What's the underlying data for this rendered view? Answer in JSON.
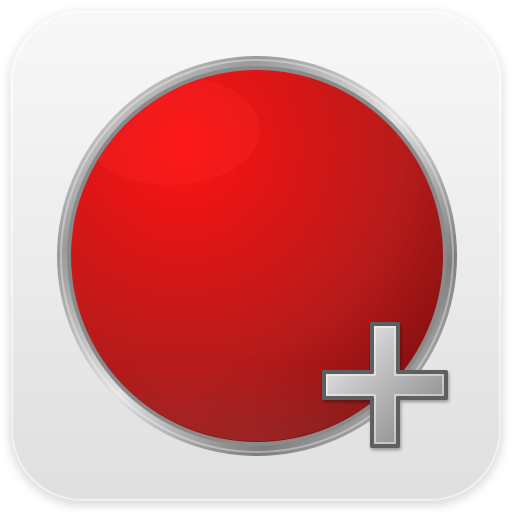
{
  "app_icon": {
    "semantic": "red-record-button-with-plus-icon",
    "colors": {
      "background_light": "#f7f7f7",
      "background_dark": "#dcdcdc",
      "red_bright": "#ff1b1b",
      "red_mid": "#c31616",
      "red_dark": "#8f1010",
      "silver_light": "#eeeeee",
      "silver_dark": "#6b6b6b"
    }
  }
}
